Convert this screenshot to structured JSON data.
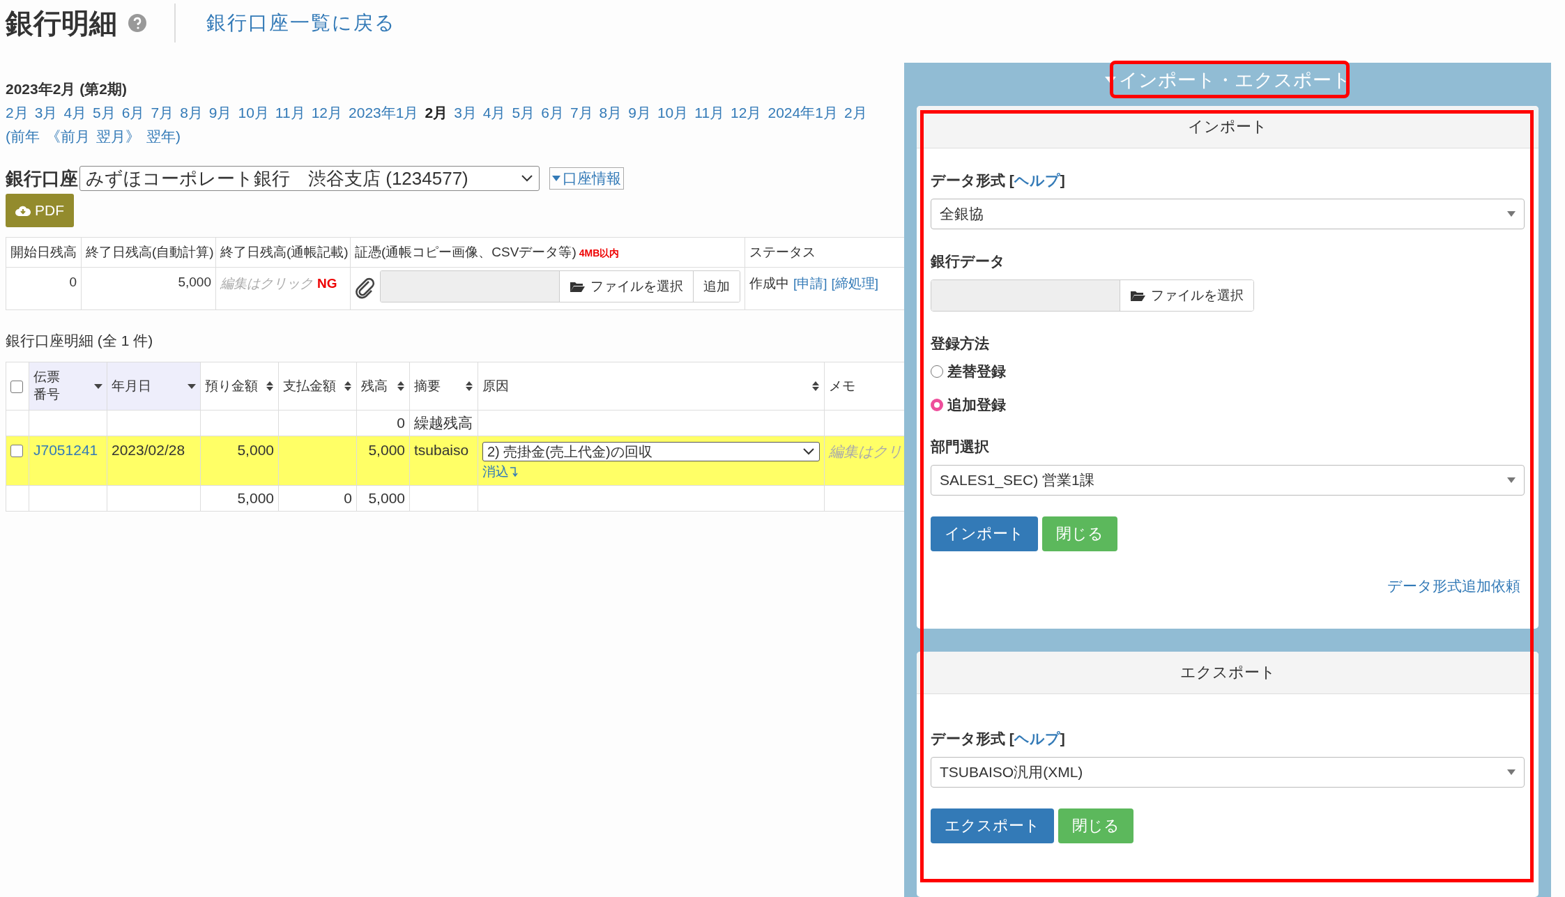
{
  "header": {
    "title": "銀行明細",
    "back_link": "銀行口座一覧に戻る"
  },
  "period": {
    "title": "2023年2月 (第2期)",
    "months": [
      {
        "label": "2月",
        "selected": false
      },
      {
        "label": "3月",
        "selected": false
      },
      {
        "label": "4月",
        "selected": false
      },
      {
        "label": "5月",
        "selected": false
      },
      {
        "label": "6月",
        "selected": false
      },
      {
        "label": "7月",
        "selected": false
      },
      {
        "label": "8月",
        "selected": false
      },
      {
        "label": "9月",
        "selected": false
      },
      {
        "label": "10月",
        "selected": false
      },
      {
        "label": "11月",
        "selected": false
      },
      {
        "label": "12月",
        "selected": false
      },
      {
        "label": "2023年1月",
        "selected": false
      },
      {
        "label": "2月",
        "selected": true
      },
      {
        "label": "3月",
        "selected": false
      },
      {
        "label": "4月",
        "selected": false
      },
      {
        "label": "5月",
        "selected": false
      },
      {
        "label": "6月",
        "selected": false
      },
      {
        "label": "7月",
        "selected": false
      },
      {
        "label": "8月",
        "selected": false
      },
      {
        "label": "9月",
        "selected": false
      },
      {
        "label": "10月",
        "selected": false
      },
      {
        "label": "11月",
        "selected": false
      },
      {
        "label": "12月",
        "selected": false
      },
      {
        "label": "2024年1月",
        "selected": false
      },
      {
        "label": "2月",
        "selected": false
      }
    ],
    "nav": [
      "(前年",
      "《前月",
      "翌月》",
      "翌年)"
    ]
  },
  "account": {
    "label": "銀行口座",
    "value": "みずほコーポレート銀行　渋谷支店 (1234577)",
    "info_link": "口座情報",
    "pdf_button": "PDF"
  },
  "summary": {
    "columns": [
      {
        "label": "開始日残高"
      },
      {
        "label": "終了日残高(自動計算)"
      },
      {
        "label": "終了日残高(通帳記載)"
      },
      {
        "label": "証憑(通帳コピー画像、CSVデータ等)",
        "note": "4MB以内"
      },
      {
        "label": "ステータス"
      }
    ],
    "start_balance": "0",
    "end_balance_auto": "5,000",
    "end_balance_placeholder": "編集はクリック",
    "check": "NG",
    "file_button": "ファイルを選択",
    "add_button": "追加",
    "status": "作成中",
    "status_links": [
      "[申請]",
      "[締処理]"
    ]
  },
  "detail": {
    "title": "銀行口座明細 (全 1 件)",
    "select_all": false,
    "columns": [
      {
        "label": "伝票番号",
        "kind": "caret",
        "sorted": true
      },
      {
        "label": "年月日",
        "kind": "caret",
        "sorted": true
      },
      {
        "label": "預り金額",
        "kind": "both",
        "sorted": false
      },
      {
        "label": "支払金額",
        "kind": "both",
        "sorted": false
      },
      {
        "label": "残高",
        "kind": "both",
        "sorted": false
      },
      {
        "label": "摘要",
        "kind": "both",
        "sorted": false
      },
      {
        "label": "原因",
        "kind": "both",
        "sorted": false
      },
      {
        "label": "メモ",
        "kind": "plain",
        "sorted": false
      }
    ],
    "rows": [
      {
        "kind": "carry",
        "balance": "0",
        "summary": "繰越残高"
      },
      {
        "kind": "entry",
        "checked": false,
        "highlighted": true,
        "voucher": "J7051241",
        "date": "2023/02/28",
        "deposit": "5,000",
        "balance": "5,000",
        "summary": "tsubaiso",
        "cause": "2) 売掛金(売上代金)の回収",
        "clear_link": "消込",
        "memo_placeholder": "編集はクリ"
      },
      {
        "kind": "total",
        "deposit": "5,000",
        "payment": "0",
        "balance": "5,000"
      }
    ]
  },
  "panel": {
    "title": "インポート・エクスポート",
    "expanded": true,
    "title_highlighted": true,
    "body_highlighted": true,
    "import": {
      "heading": "インポート",
      "format_label": "データ形式",
      "format_help_open": "[",
      "format_help": "ヘルプ",
      "format_help_close": "]",
      "format_value": "全銀協",
      "data_label": "銀行データ",
      "file_button": "ファイルを選択",
      "method_label": "登録方法",
      "methods": [
        {
          "label": "差替登録",
          "selected": false
        },
        {
          "label": "追加登録",
          "selected": true
        }
      ],
      "dept_label": "部門選択",
      "dept_value": "SALES1_SEC) 営業1課",
      "submit": "インポート",
      "close": "閉じる",
      "request_link": "データ形式追加依頼"
    },
    "export": {
      "heading": "エクスポート",
      "format_label": "データ形式",
      "format_help_open": "[",
      "format_help": "ヘルプ",
      "format_help_close": "]",
      "format_value": "TSUBAISO汎用(XML)",
      "submit": "エクスポート",
      "close": "閉じる"
    }
  }
}
